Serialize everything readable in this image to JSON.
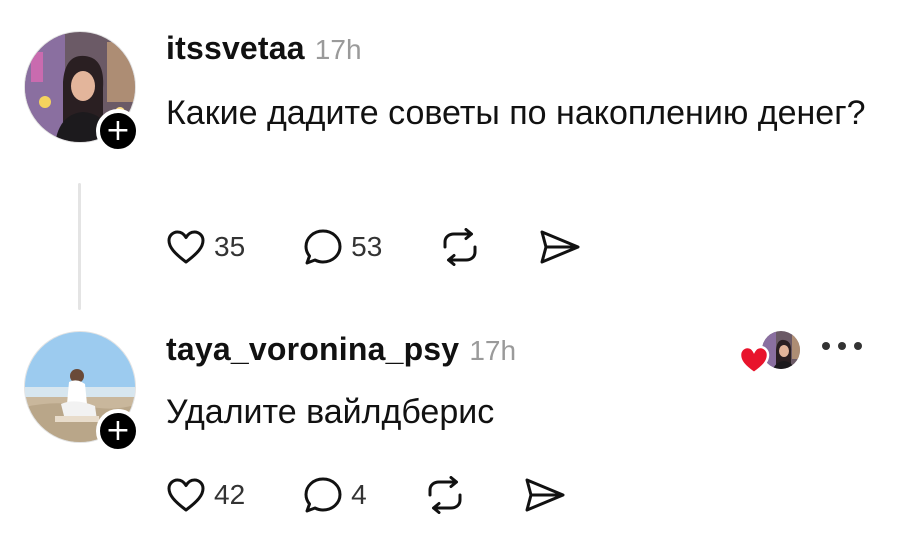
{
  "posts": [
    {
      "username": "itssvetaa",
      "time": "17h",
      "text": "Какие дадите советы по накоплению денег?",
      "likes": "35",
      "comments": "53",
      "icons": [
        "heart-icon",
        "comment-icon",
        "repost-icon",
        "share-icon"
      ]
    },
    {
      "username": "taya_voronina_psy",
      "time": "17h",
      "text": "Удалите вайлдберис",
      "likes": "42",
      "comments": "4",
      "icons": [
        "heart-icon",
        "comment-icon",
        "repost-icon",
        "share-icon"
      ]
    }
  ],
  "follow_symbol": "+",
  "colors": {
    "text": "#111111",
    "muted": "#9a9a9a",
    "thread_line": "#e4e4e4",
    "heart_red": "#e8142c"
  }
}
